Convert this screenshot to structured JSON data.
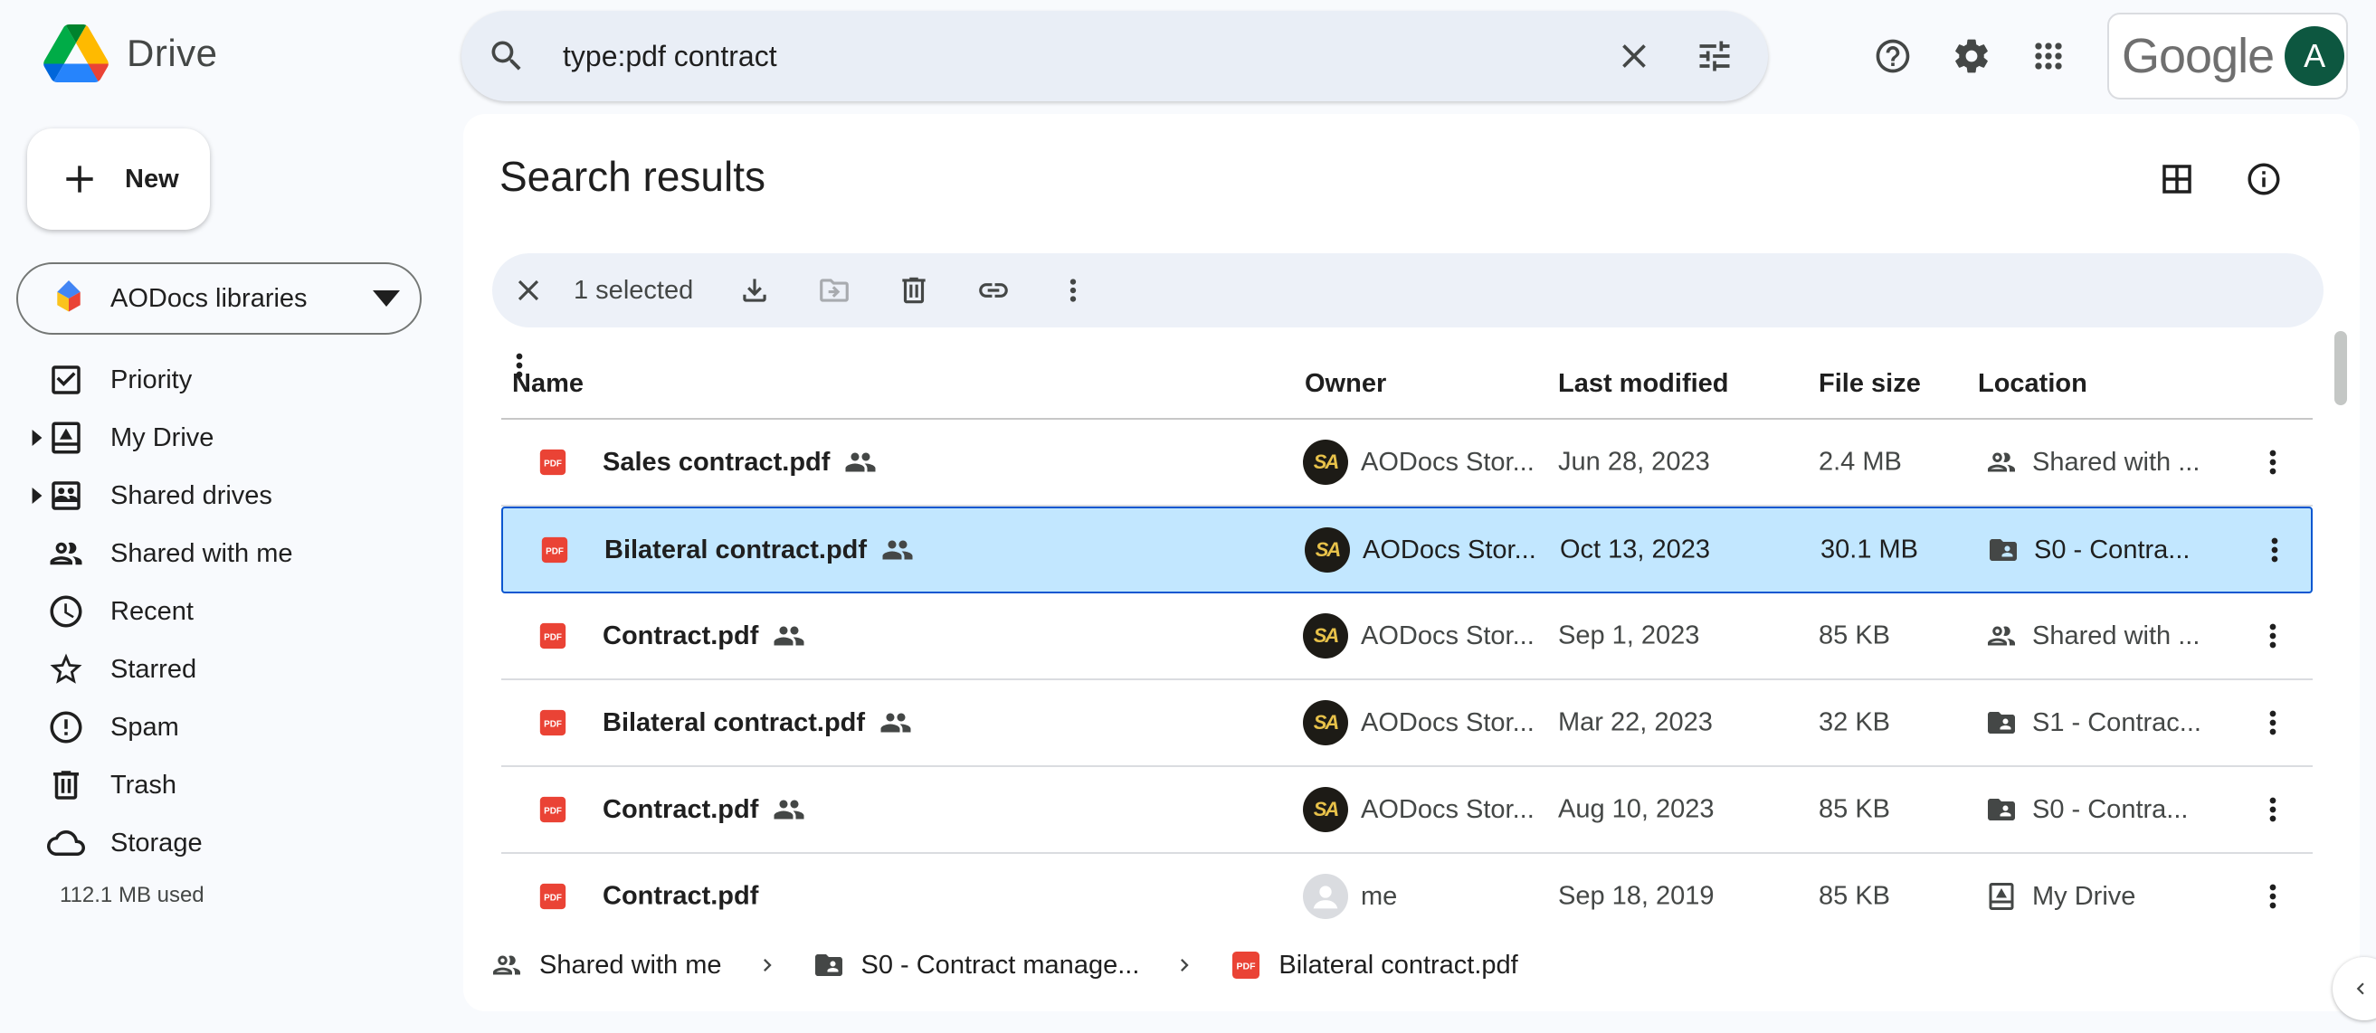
{
  "app": {
    "name": "Drive"
  },
  "search": {
    "query": "type:pdf contract"
  },
  "account": {
    "brand": "Google",
    "avatar_letter": "A"
  },
  "sidebar": {
    "new_label": "New",
    "library_selector": "AODocs libraries",
    "items": [
      {
        "label": "Priority",
        "icon": "priority-icon"
      },
      {
        "label": "My Drive",
        "icon": "my-drive-icon",
        "expandable": true
      },
      {
        "label": "Shared drives",
        "icon": "shared-drives-icon",
        "expandable": true
      },
      {
        "label": "Shared with me",
        "icon": "shared-with-me-icon"
      },
      {
        "label": "Recent",
        "icon": "clock-icon"
      },
      {
        "label": "Starred",
        "icon": "star-icon"
      },
      {
        "label": "Spam",
        "icon": "spam-icon"
      },
      {
        "label": "Trash",
        "icon": "trash-icon"
      },
      {
        "label": "Storage",
        "icon": "cloud-icon"
      }
    ],
    "storage_used": "112.1 MB used"
  },
  "main": {
    "title": "Search results",
    "selection": {
      "count_label": "1 selected"
    },
    "columns": {
      "name": "Name",
      "owner": "Owner",
      "modified": "Last modified",
      "size": "File size",
      "location": "Location"
    },
    "rows": [
      {
        "name": "Sales contract.pdf",
        "shared": true,
        "owner": "AODocs Stor...",
        "owner_avatar": "SA",
        "modified": "Jun 28, 2023",
        "size": "2.4 MB",
        "location": "Shared with ...",
        "location_icon": "shared-with-me-icon",
        "selected": false
      },
      {
        "name": "Bilateral contract.pdf",
        "shared": true,
        "owner": "AODocs Stor...",
        "owner_avatar": "SA",
        "modified": "Oct 13, 2023",
        "size": "30.1 MB",
        "location": "S0 - Contra...",
        "location_icon": "shared-drive-folder-icon",
        "selected": true
      },
      {
        "name": "Contract.pdf",
        "shared": true,
        "owner": "AODocs Stor...",
        "owner_avatar": "SA",
        "modified": "Sep 1, 2023",
        "size": "85 KB",
        "location": "Shared with ...",
        "location_icon": "shared-with-me-icon",
        "selected": false
      },
      {
        "name": "Bilateral contract.pdf",
        "shared": true,
        "owner": "AODocs Stor...",
        "owner_avatar": "SA",
        "modified": "Mar 22, 2023",
        "size": "32 KB",
        "location": "S1 - Contrac...",
        "location_icon": "shared-drive-folder-icon",
        "selected": false
      },
      {
        "name": "Contract.pdf",
        "shared": true,
        "owner": "AODocs Stor...",
        "owner_avatar": "SA",
        "modified": "Aug 10, 2023",
        "size": "85 KB",
        "location": "S0 - Contra...",
        "location_icon": "shared-drive-folder-icon",
        "selected": false
      },
      {
        "name": "Contract.pdf",
        "shared": false,
        "owner": "me",
        "owner_avatar": "",
        "modified": "Sep 18, 2019",
        "size": "85 KB",
        "location": "My Drive",
        "location_icon": "my-drive-icon",
        "selected": false
      }
    ],
    "breadcrumb": [
      "Shared with me",
      "S0 - Contract manage...",
      "Bilateral contract.pdf"
    ]
  },
  "colors": {
    "background": "#f8fafd",
    "search_bg": "#e9eef6",
    "selected_row_bg": "#c2e7ff",
    "selected_row_border": "#0b57d0",
    "pdf_red": "#ea4335",
    "avatar_green": "#0d5740"
  }
}
